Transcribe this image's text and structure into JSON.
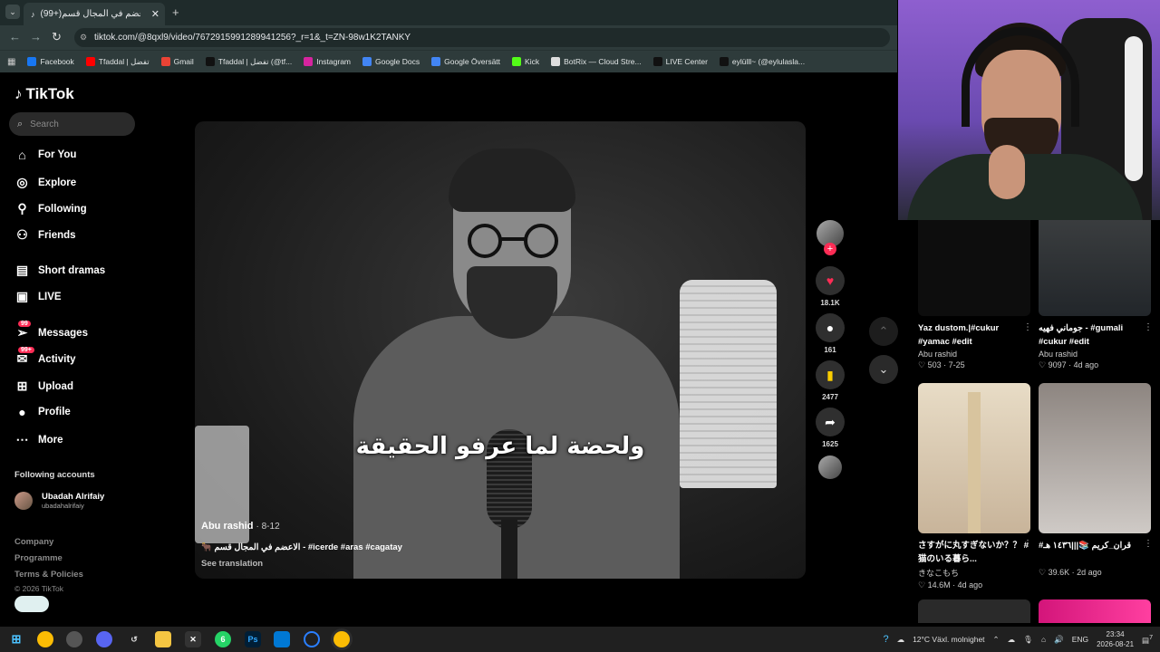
{
  "browser": {
    "tab_title": "(99+)الاعضم في المجال قسم 🐂",
    "tab_close": "✕",
    "new_tab": "+",
    "url": "tiktok.com/@8qxl9/video/7672915991289941256?_r=1&_t=ZN-98w1K2TANKY",
    "bookmarks": [
      {
        "label": "Facebook",
        "color": "#1877f2"
      },
      {
        "label": "Tfaddal | تفضل",
        "color": "#ff0000"
      },
      {
        "label": "Gmail",
        "color": "#ea4335"
      },
      {
        "label": "Tfaddal | تفضل (@tf...",
        "color": "#111111"
      },
      {
        "label": "Instagram",
        "color": "#d6249f"
      },
      {
        "label": "Google Docs",
        "color": "#4285f4"
      },
      {
        "label": "Google Översätt",
        "color": "#4285f4"
      },
      {
        "label": "Kick",
        "color": "#53fc18"
      },
      {
        "label": "BotRix — Cloud Stre...",
        "color": "#dddddd"
      },
      {
        "label": "LIVE Center",
        "color": "#111111"
      },
      {
        "label": "eylülll~ (@eylulasla...",
        "color": "#111111"
      }
    ]
  },
  "tiktok": {
    "logo": "TikTok",
    "search_placeholder": "Search",
    "nav": [
      {
        "label": "For You",
        "icon": "home-icon"
      },
      {
        "label": "Explore",
        "icon": "compass-icon"
      },
      {
        "label": "Following",
        "icon": "user-follow-icon"
      },
      {
        "label": "Friends",
        "icon": "friends-icon"
      },
      {
        "label": "Short dramas",
        "icon": "film-icon"
      },
      {
        "label": "LIVE",
        "icon": "live-icon"
      },
      {
        "label": "Messages",
        "icon": "send-icon",
        "badge": "99"
      },
      {
        "label": "Activity",
        "icon": "inbox-icon",
        "badge": "99+"
      },
      {
        "label": "Upload",
        "icon": "plus-square-icon"
      },
      {
        "label": "Profile",
        "icon": "avatar-icon"
      },
      {
        "label": "More",
        "icon": "more-icon"
      }
    ],
    "following_title": "Following accounts",
    "following_account": {
      "name": "Ubadah Alrifaiy",
      "username": "ubadahalrifaiy"
    },
    "footer": [
      "Company",
      "Programme",
      "Terms & Policies"
    ],
    "copyright": "© 2026 TikTok"
  },
  "video": {
    "caption": "ولحضة لما عرفو الحقيقة",
    "author": "Abu rashid",
    "date": "· 8-12",
    "description": "🐂 الاعضم في المجال قسم - #icerde #aras #cagatay",
    "see_translation": "See translation",
    "likes": "18.1K",
    "comments": "161",
    "saves": "2477",
    "shares": "1625"
  },
  "feed": [
    {
      "title": "Yaz dustom.|#cukur #yamac #edit",
      "author": "Abu rashid",
      "likes": "503",
      "age": "7-25"
    },
    {
      "title": "جوماني فهيه - #gumali #cukur #edit",
      "author": "Abu rashid",
      "likes": "9097",
      "age": "4d ago"
    },
    {
      "title": "さすがに丸すぎないか？？ #猫のいる暮ら...",
      "author": "きなこもち",
      "likes": "14.6M",
      "age": "4d ago"
    },
    {
      "title": "#قران_كريم 📚|||١٤٣٦ هـ",
      "author": "",
      "likes": "39.6K",
      "age": "2d ago"
    }
  ],
  "taskbar": {
    "weather": "12°C  Växl. molnighet",
    "lang": "ENG",
    "time": "23:34",
    "date": "2026-08-21",
    "notif": "7"
  }
}
